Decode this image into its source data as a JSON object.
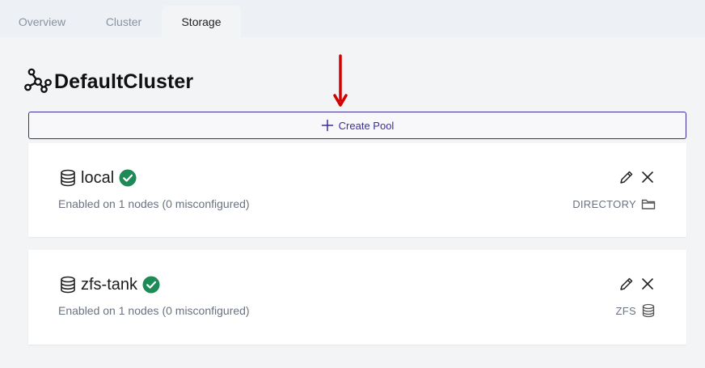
{
  "tabs": [
    {
      "label": "Overview",
      "active": false
    },
    {
      "label": "Cluster",
      "active": false
    },
    {
      "label": "Storage",
      "active": true
    }
  ],
  "cluster": {
    "name": "DefaultCluster",
    "icon": "cluster-network-icon"
  },
  "create_pool": {
    "label": "Create Pool",
    "icon": "plus-icon",
    "color": "#3b2e9a"
  },
  "annotation": {
    "icon": "red-down-arrow-icon",
    "color": "#d40000"
  },
  "pools": [
    {
      "name": "local",
      "status_icon": "check-circle-icon",
      "status_color": "#1e8a57",
      "description": "Enabled on 1 nodes (0 misconfigured)",
      "type": "DIRECTORY",
      "type_icon": "folder-icon"
    },
    {
      "name": "zfs-tank",
      "status_icon": "check-circle-icon",
      "status_color": "#1e8a57",
      "description": "Enabled on 1 nodes (0 misconfigured)",
      "type": "ZFS",
      "type_icon": "database-icon"
    }
  ]
}
